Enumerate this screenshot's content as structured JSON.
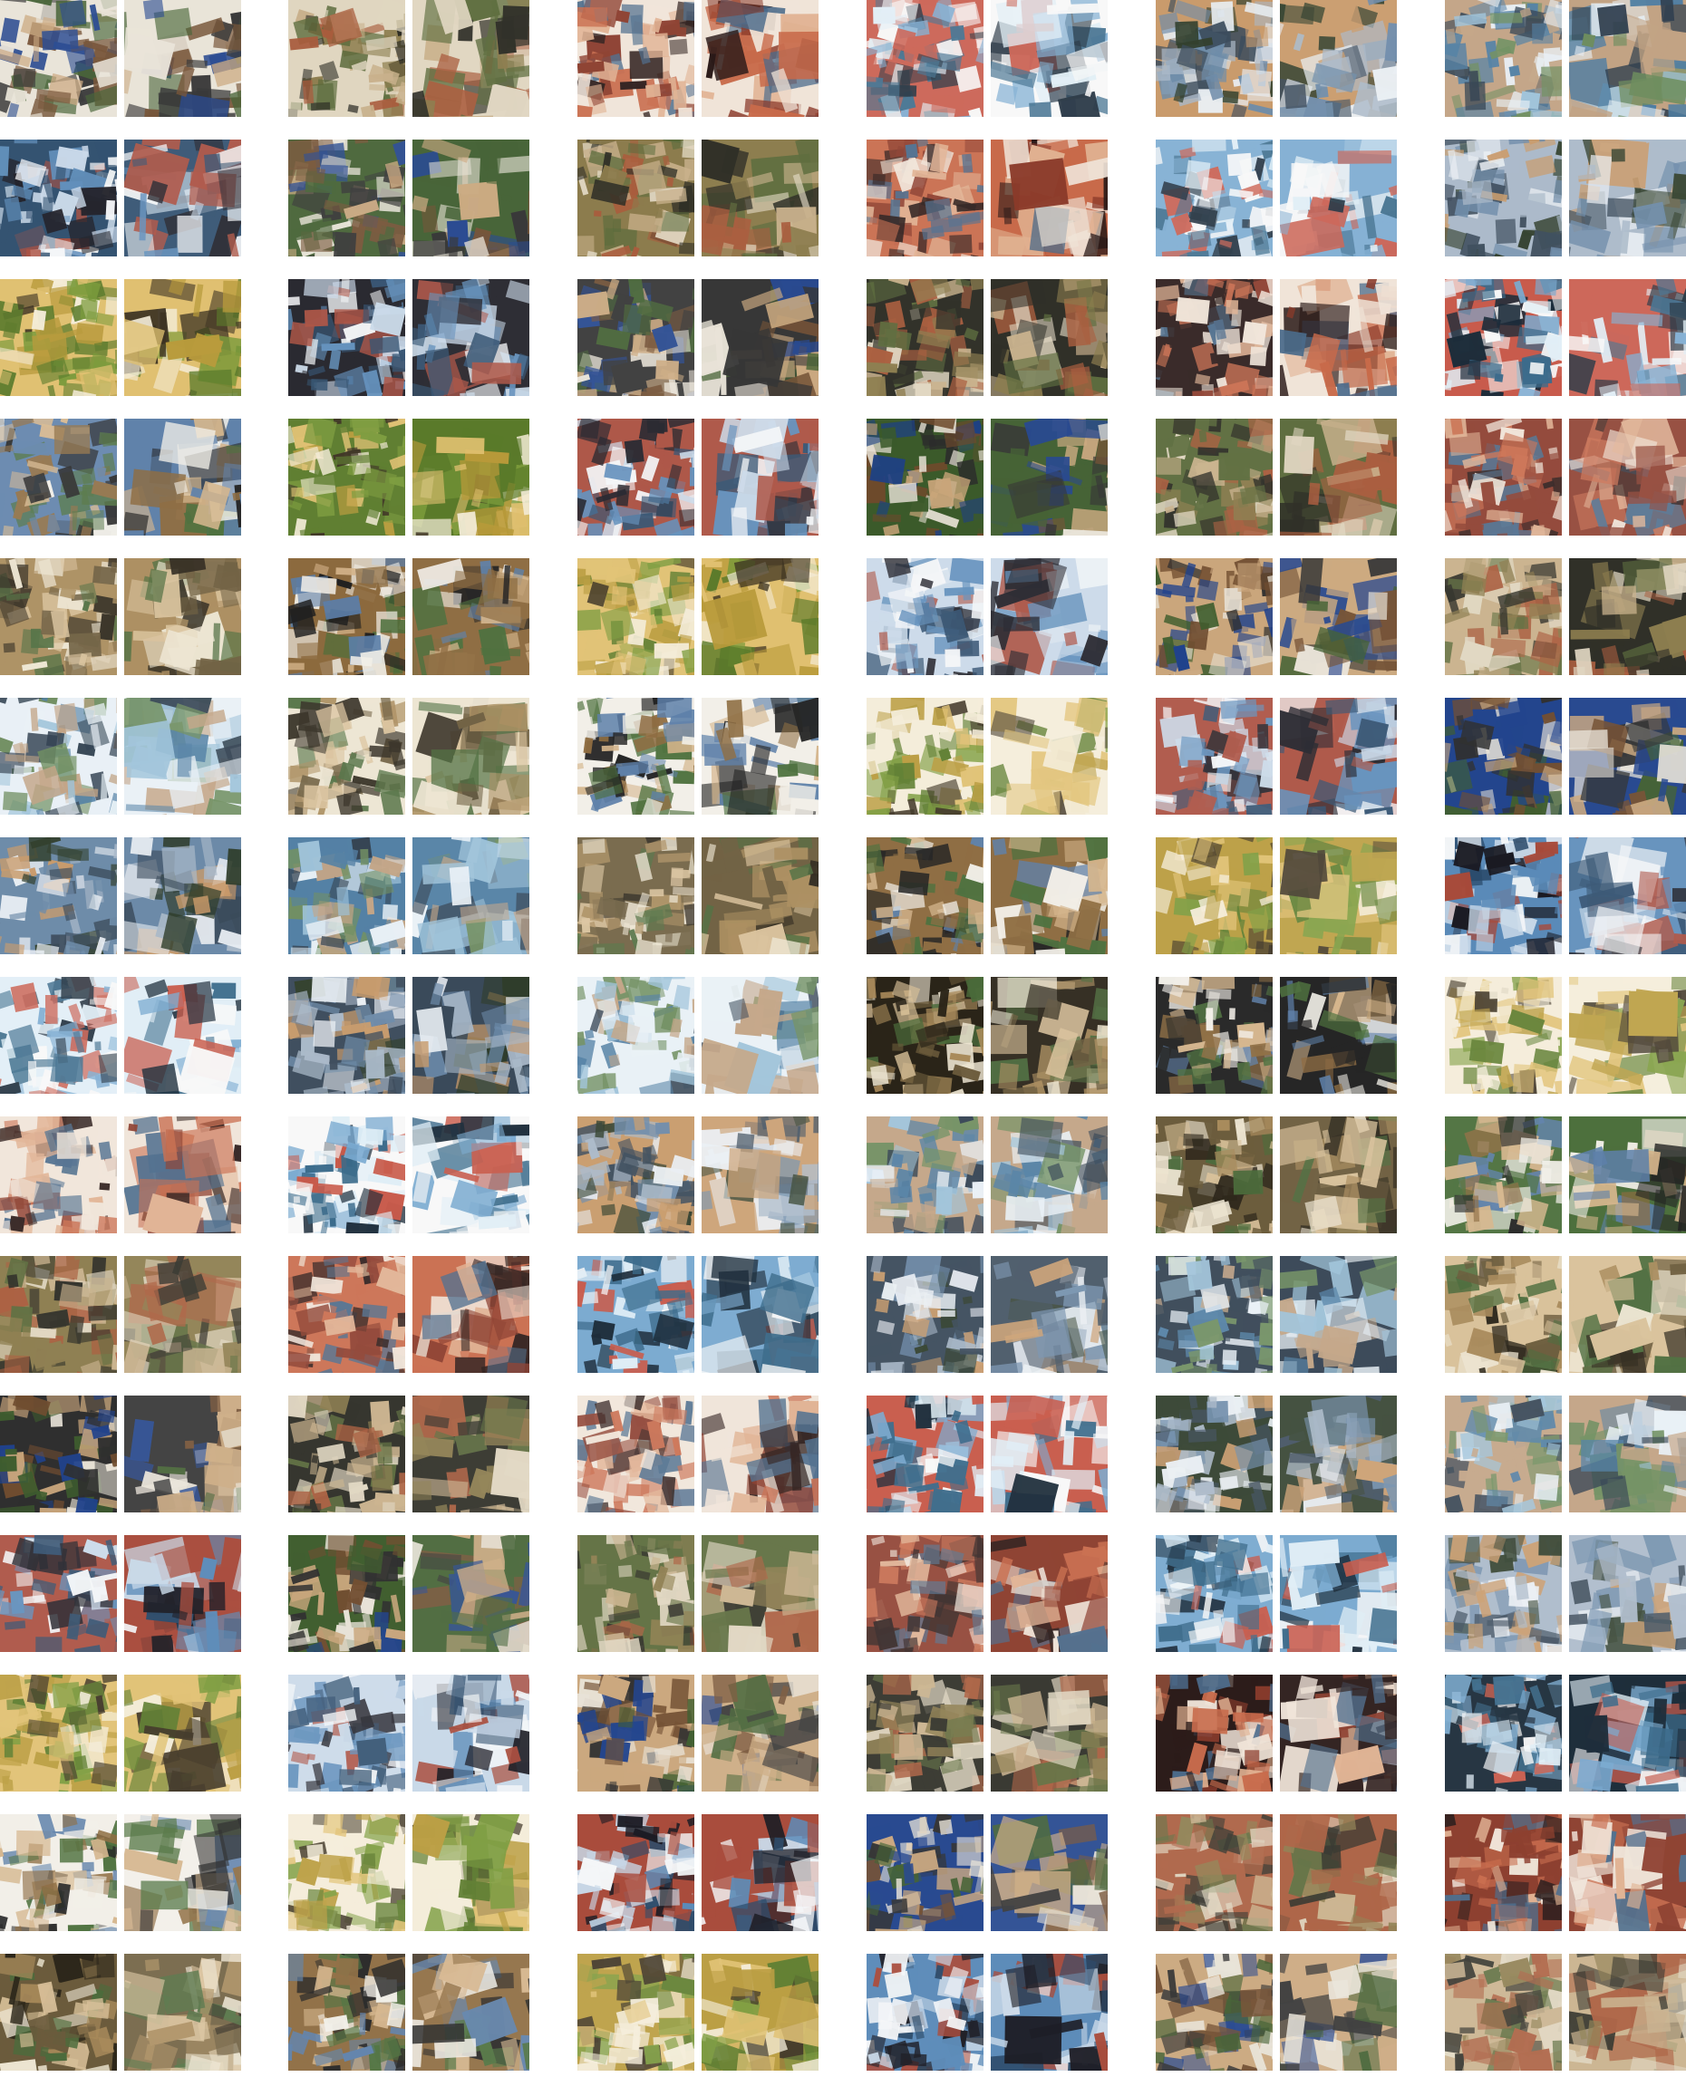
{
  "figure": {
    "description_type": "sample-grid",
    "rows": 15,
    "pair_columns": 6,
    "images_per_pair": 2
  },
  "palettes": [
    [
      "#3b5a2a",
      "#6e4a2c",
      "#c9a57a",
      "#2b2b2b",
      "#e8e2d6",
      "#1c3f8a"
    ],
    [
      "#4a6e3a",
      "#8c6a3e",
      "#d4b48a",
      "#1f1f1f",
      "#f2efe8",
      "#5b7ea8"
    ],
    [
      "#6c8aa8",
      "#a9b8c8",
      "#3a4a5a",
      "#e9eef3",
      "#2f3d2a",
      "#c89a6a"
    ],
    [
      "#5a6a3a",
      "#8a7a4a",
      "#c8b08a",
      "#2a2a22",
      "#e0d6c0",
      "#a85a3a"
    ],
    [
      "#7a9a3a",
      "#b89a3a",
      "#e0c070",
      "#3a3020",
      "#f4ecd8",
      "#5a7a2a"
    ],
    [
      "#4a7aa0",
      "#9ac0d8",
      "#2a3a4a",
      "#e8f0f6",
      "#6a8a5a",
      "#c0a080"
    ],
    [
      "#8a3a2a",
      "#c86a4a",
      "#e0b090",
      "#2a1a18",
      "#f0e4d8",
      "#4a6a8a"
    ],
    [
      "#2a4a6a",
      "#5a8ab8",
      "#c8d8e8",
      "#1a1a22",
      "#f4f6f8",
      "#a84a3a"
    ],
    [
      "#6a5a3a",
      "#a88a5a",
      "#d8c098",
      "#2a2418",
      "#ece4d0",
      "#4a6a3a"
    ],
    [
      "#3a6a8a",
      "#7aaad0",
      "#e0eef6",
      "#1a2a38",
      "#c85a4a",
      "#f8f8f8"
    ]
  ]
}
